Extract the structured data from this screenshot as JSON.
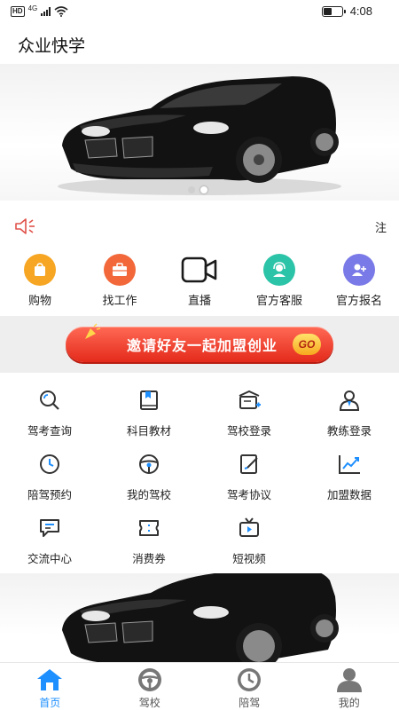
{
  "status_bar": {
    "hd": "HD",
    "network": "4G",
    "time": "4:08",
    "battery_level": 0.45
  },
  "header": {
    "title": "众业快学"
  },
  "notice": {
    "text": "注"
  },
  "quick_entries": [
    {
      "label": "购物",
      "icon": "shopping-bag-icon",
      "color": "#f6a623"
    },
    {
      "label": "找工作",
      "icon": "briefcase-icon",
      "color": "#f2683a"
    },
    {
      "label": "直播",
      "icon": "video-camera-icon",
      "color": "#1a1a1a"
    },
    {
      "label": "官方客服",
      "icon": "customer-service-icon",
      "color": "#2cc4a8"
    },
    {
      "label": "官方报名",
      "icon": "add-user-icon",
      "color": "#7a79e8"
    }
  ],
  "invite": {
    "label": "邀请好友一起加盟创业",
    "go": "GO"
  },
  "grid": [
    {
      "label": "驾考查询",
      "icon": "search-icon"
    },
    {
      "label": "科目教材",
      "icon": "book-icon"
    },
    {
      "label": "驾校登录",
      "icon": "school-login-icon"
    },
    {
      "label": "教练登录",
      "icon": "coach-icon"
    },
    {
      "label": "陪驾预约",
      "icon": "clock-icon"
    },
    {
      "label": "我的驾校",
      "icon": "steering-wheel-icon"
    },
    {
      "label": "驾考协议",
      "icon": "edit-document-icon"
    },
    {
      "label": "加盟数据",
      "icon": "trend-chart-icon"
    },
    {
      "label": "交流中心",
      "icon": "chat-icon"
    },
    {
      "label": "消费券",
      "icon": "coupon-icon"
    },
    {
      "label": "短视频",
      "icon": "tv-icon"
    }
  ],
  "tabs": [
    {
      "label": "首页",
      "icon": "home-icon",
      "active": true
    },
    {
      "label": "驾校",
      "icon": "steering-wheel-icon",
      "active": false
    },
    {
      "label": "陪驾",
      "icon": "clock-icon",
      "active": false
    },
    {
      "label": "我的",
      "icon": "user-icon",
      "active": false
    }
  ],
  "colors": {
    "accent": "#1e8fff",
    "invite_red": "#e42a1b",
    "grid_icon": "#333333"
  }
}
